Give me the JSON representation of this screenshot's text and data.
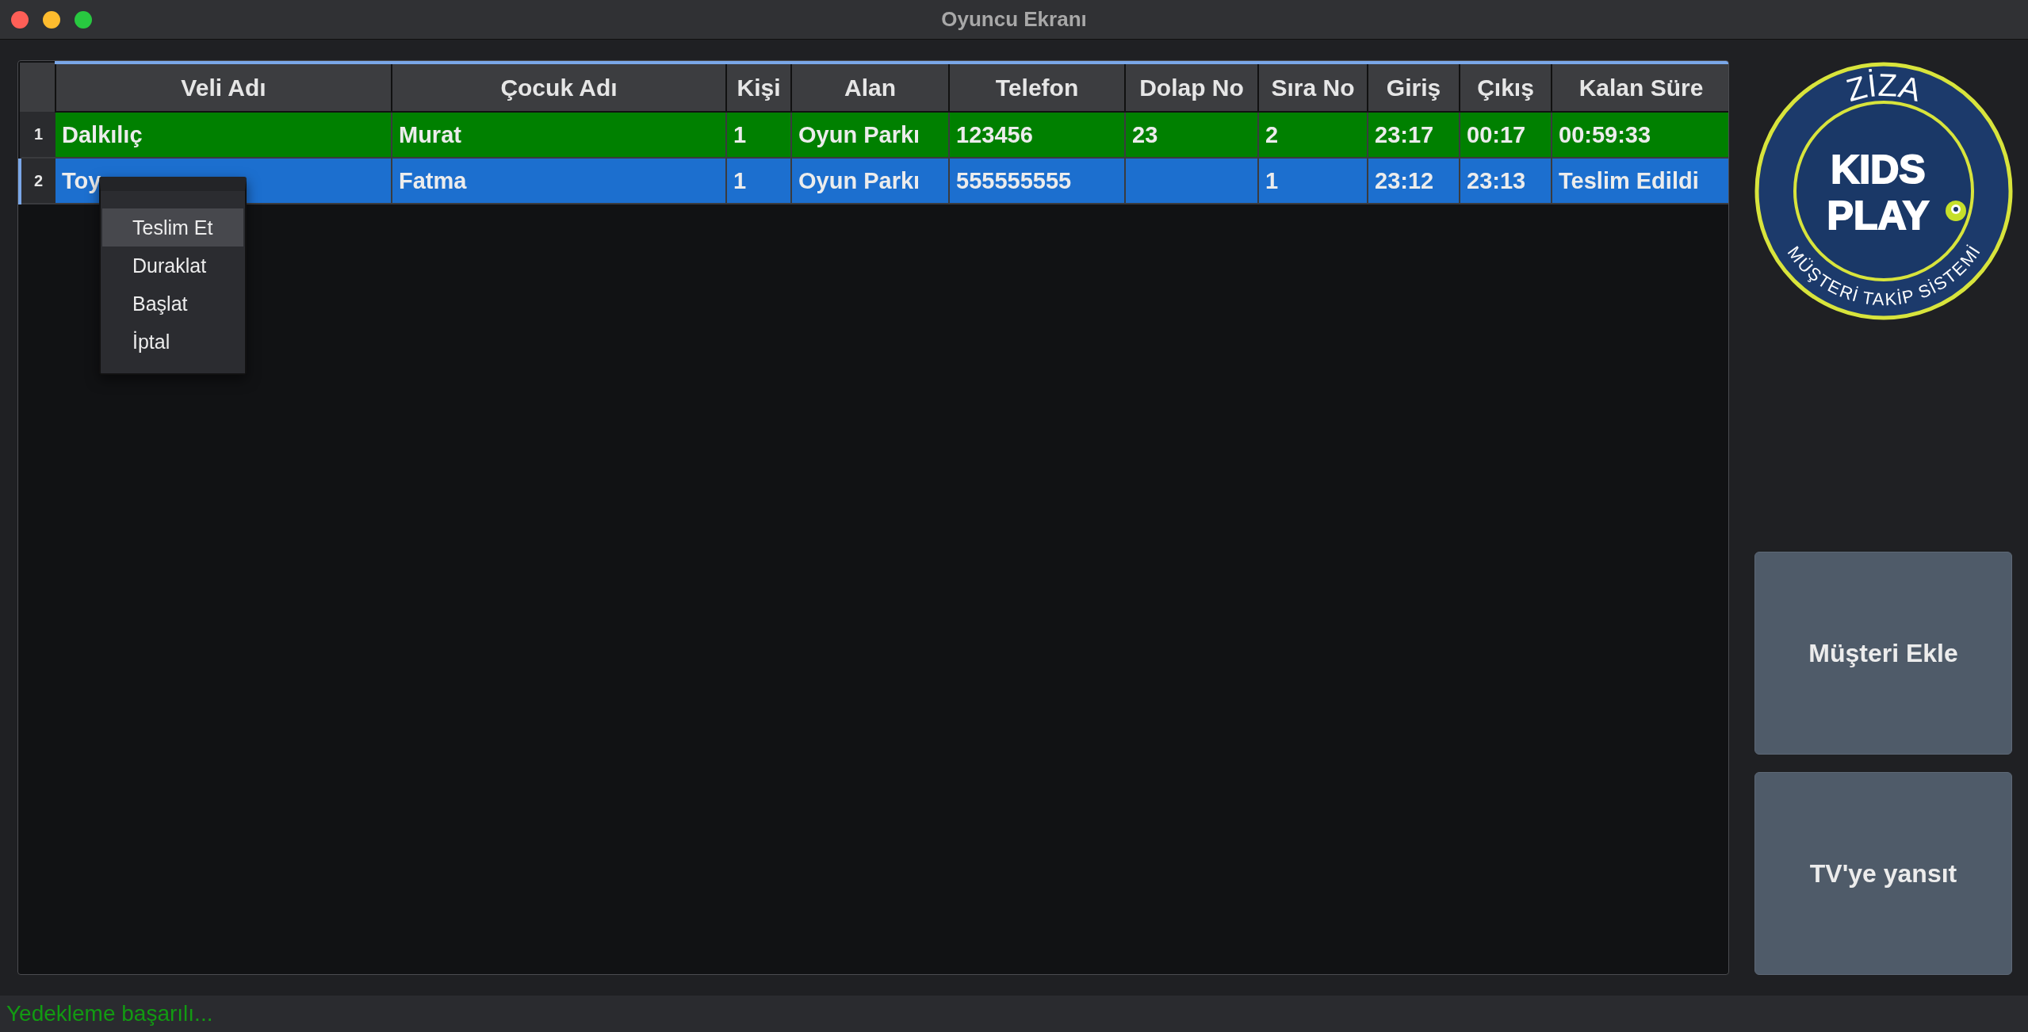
{
  "window": {
    "title": "Oyuncu Ekranı"
  },
  "table": {
    "columns": [
      "Veli Adı",
      "Çocuk Adı",
      "Kişi",
      "Alan",
      "Telefon",
      "Dolap No",
      "Sıra No",
      "Giriş",
      "Çıkış",
      "Kalan Süre"
    ],
    "rows": [
      {
        "number": "1",
        "selected": false,
        "color": "#008000",
        "cells": [
          "Dalkılıç",
          "Murat",
          "1",
          "Oyun Parkı",
          "123456",
          "23",
          "2",
          "23:17",
          "00:17",
          "00:59:33"
        ]
      },
      {
        "number": "2",
        "selected": true,
        "color": "#1c6fcf",
        "cells": [
          "Toy",
          "Fatma",
          "1",
          "Oyun Parkı",
          "555555555",
          "",
          "1",
          "23:12",
          "23:13",
          "Teslim Edildi"
        ]
      }
    ]
  },
  "context_menu": {
    "items": [
      {
        "label": "Teslim Et",
        "selected": true
      },
      {
        "label": "Duraklat",
        "selected": false
      },
      {
        "label": "Başlat",
        "selected": false
      },
      {
        "label": "İptal",
        "selected": false
      }
    ]
  },
  "logo": {
    "top": "ZİZA",
    "main": [
      "KIDS",
      "PLAY"
    ],
    "bottom": "MÜŞTERİ TAKİP SİSTEMİ"
  },
  "buttons": [
    "Müşteri Ekle",
    "TV'ye yansıt"
  ],
  "status_bar": "Yedekleme başarılı..."
}
